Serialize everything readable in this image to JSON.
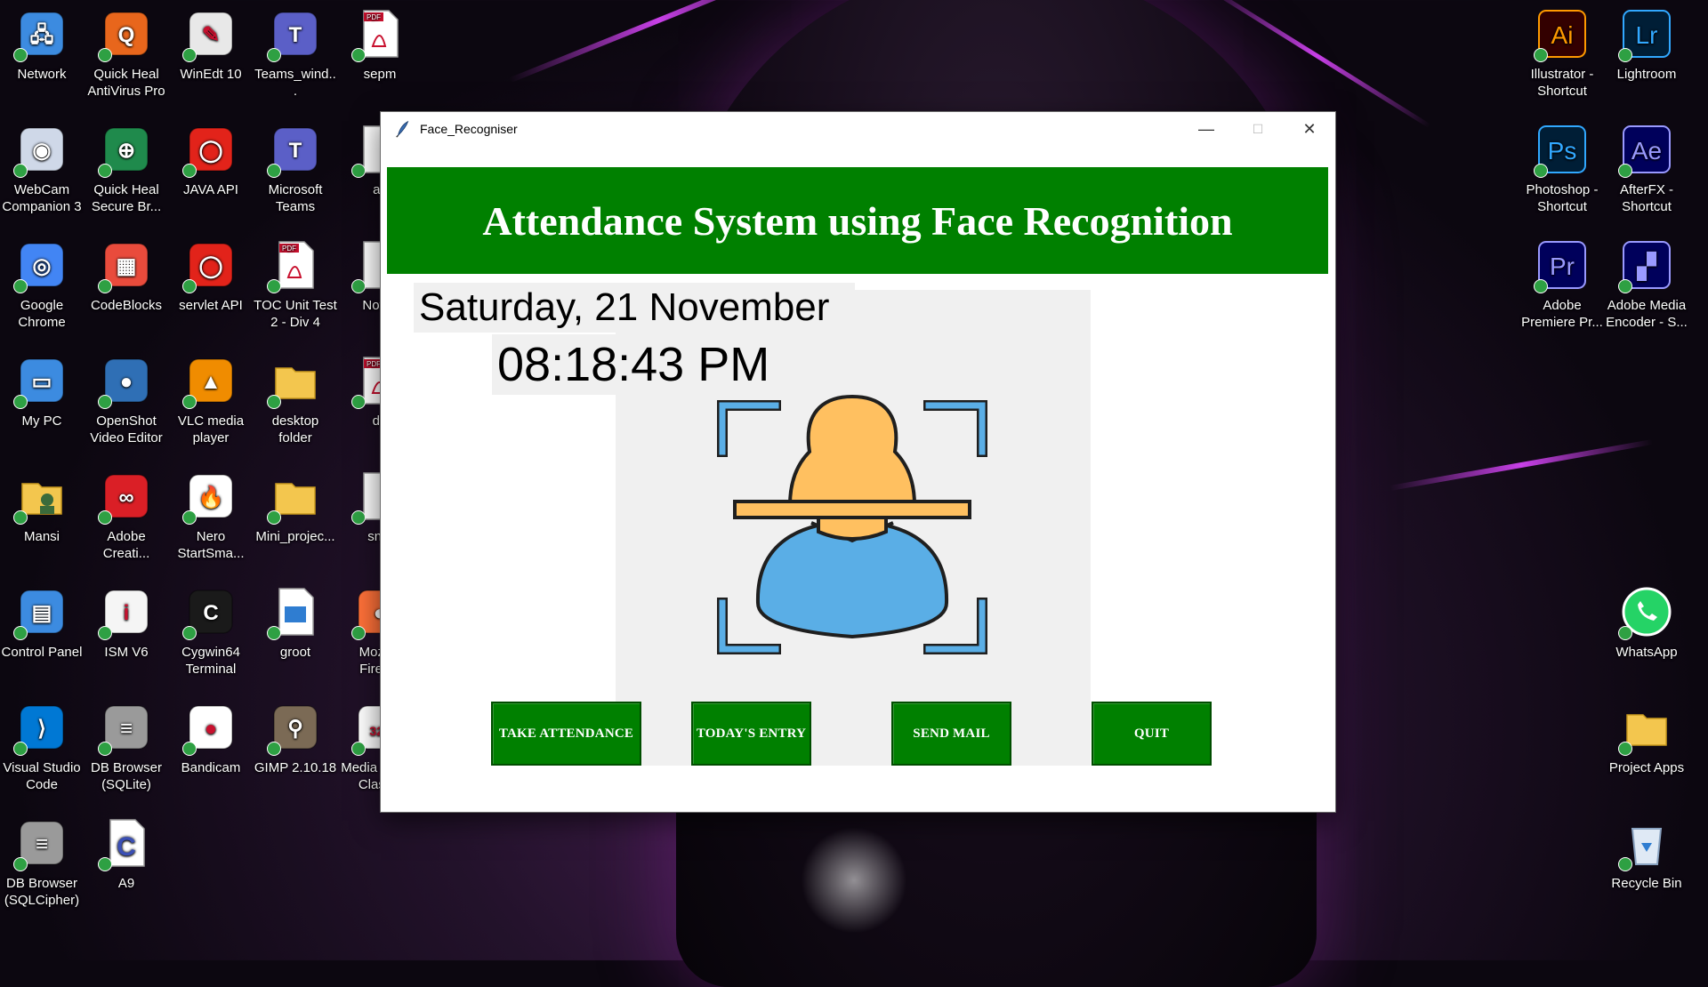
{
  "window": {
    "title": "Face_Recogniser",
    "minimize_glyph": "—",
    "maximize_glyph": "☐",
    "close_glyph": "✕"
  },
  "app": {
    "header": "Attendance System using Face Recognition",
    "date": "Saturday, 21 November",
    "time": "08:18:43 PM",
    "buttons": {
      "take_attendance": "TAKE ATTENDANCE",
      "todays_entry": "TODAY'S ENTRY",
      "send_mail": "SEND MAIL",
      "quit": "QUIT"
    },
    "colors": {
      "header_bg": "#008000",
      "button_bg": "#008000",
      "panel_bg": "#f0f0f0"
    }
  },
  "desktop_icons_left": [
    {
      "label": "Network",
      "icon": "network-icon"
    },
    {
      "label": "Quick Heal\nAntiVirus Pro",
      "icon": "quickheal-icon"
    },
    {
      "label": "WinEdt 10",
      "icon": "winedt-icon"
    },
    {
      "label": "Teams_wind...",
      "icon": "teams-icon"
    },
    {
      "label": "sepm",
      "icon": "pdf-icon"
    },
    {
      "label": "WebCam\nCompanion 3",
      "icon": "webcam-icon"
    },
    {
      "label": "Quick Heal\nSecure Br...",
      "icon": "quickheal-browser-icon"
    },
    {
      "label": "JAVA API",
      "icon": "oracle-icon"
    },
    {
      "label": "Microsoft\nTeams",
      "icon": "teams-icon"
    },
    {
      "label": "as",
      "icon": "file-icon"
    },
    {
      "label": "Google\nChrome",
      "icon": "chrome-icon"
    },
    {
      "label": "CodeBlocks",
      "icon": "codeblocks-icon"
    },
    {
      "label": "servlet API",
      "icon": "oracle-icon"
    },
    {
      "label": "TOC Unit Test\n2 - Div 4",
      "icon": "pdf-icon"
    },
    {
      "label": "Notes",
      "icon": "file-icon"
    },
    {
      "label": "My PC",
      "icon": "computer-icon"
    },
    {
      "label": "OpenShot\nVideo Editor",
      "icon": "openshot-icon"
    },
    {
      "label": "VLC media\nplayer",
      "icon": "vlc-icon"
    },
    {
      "label": "desktop\nfolder",
      "icon": "folder-icon"
    },
    {
      "label": "db",
      "icon": "pdf-icon"
    },
    {
      "label": "Mansi",
      "icon": "user-folder-icon"
    },
    {
      "label": "Adobe\nCreati...",
      "icon": "adobe-cc-icon"
    },
    {
      "label": "Nero\nStartSma...",
      "icon": "nero-icon"
    },
    {
      "label": "Mini_projec...",
      "icon": "folder-icon"
    },
    {
      "label": "snip",
      "icon": "file-icon"
    },
    {
      "label": "Control Panel",
      "icon": "control-panel-icon"
    },
    {
      "label": "ISM V6",
      "icon": "ism-icon"
    },
    {
      "label": "Cygwin64\nTerminal",
      "icon": "terminal-icon"
    },
    {
      "label": "groot",
      "icon": "image-icon"
    },
    {
      "label": "Mozilla\nFirefox",
      "icon": "firefox-icon"
    },
    {
      "label": "Visual Studio\nCode",
      "icon": "vscode-icon"
    },
    {
      "label": "DB Browser\n(SQLite)",
      "icon": "database-icon"
    },
    {
      "label": "Bandicam",
      "icon": "bandicam-icon"
    },
    {
      "label": "GIMP 2.10.18",
      "icon": "gimp-icon"
    },
    {
      "label": "Media Player\nClassic",
      "icon": "mpc-icon"
    },
    {
      "label": "DB Browser\n(SQLCipher)",
      "icon": "database-icon"
    },
    {
      "label": "A9",
      "icon": "c-file-icon"
    }
  ],
  "desktop_icons_right": [
    {
      "label": "Illustrator -\nShortcut",
      "icon": "illustrator-icon",
      "text": "Ai"
    },
    {
      "label": "Lightroom",
      "icon": "lightroom-icon",
      "text": "Lr"
    },
    {
      "label": "Photoshop -\nShortcut",
      "icon": "photoshop-icon",
      "text": "Ps"
    },
    {
      "label": "AfterFX -\nShortcut",
      "icon": "aftereffects-icon",
      "text": "Ae"
    },
    {
      "label": "Adobe\nPremiere Pr...",
      "icon": "premiere-icon",
      "text": "Pr"
    },
    {
      "label": "Adobe Media\nEncoder - S...",
      "icon": "media-encoder-icon",
      "text": ""
    },
    {
      "label": "WhatsApp",
      "icon": "whatsapp-icon",
      "text": ""
    },
    {
      "label": "Project Apps",
      "icon": "folder-icon",
      "text": ""
    },
    {
      "label": "Recycle Bin",
      "icon": "recycle-bin-icon",
      "text": ""
    }
  ]
}
